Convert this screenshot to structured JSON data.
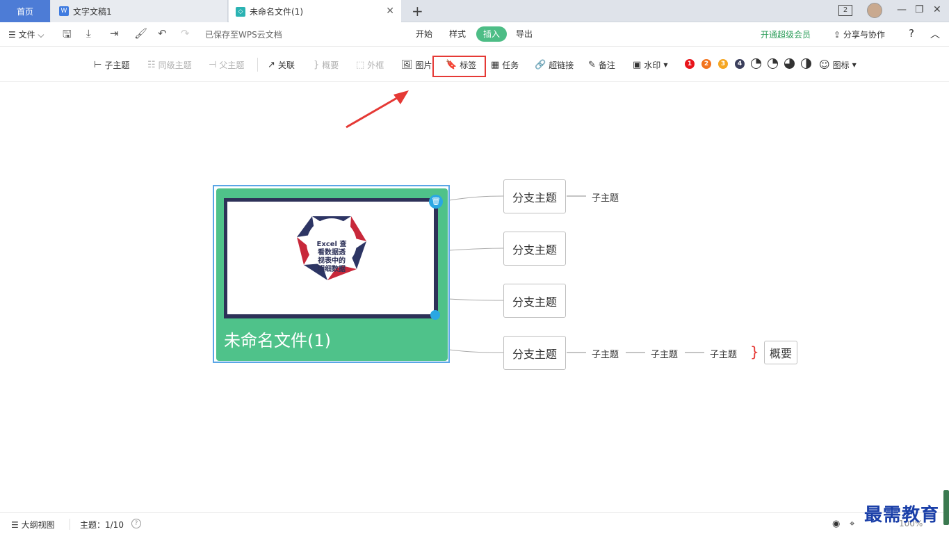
{
  "tabs": {
    "home": "首页",
    "doc": "文字文稿1",
    "active": "未命名文件(1)",
    "window_count": "2"
  },
  "menubar": {
    "file": "文件",
    "saved_status": "已保存至WPS云文档",
    "tabs": [
      "开始",
      "样式",
      "插入",
      "导出"
    ],
    "vip": "开通超级会员",
    "share": "分享与协作",
    "help": "?"
  },
  "toolbar": {
    "subtopic": "子主题",
    "sibling": "同级主题",
    "parent": "父主题",
    "relation": "关联",
    "summary": "概要",
    "frame": "外框",
    "image": "图片",
    "label": "标签",
    "task": "任务",
    "hyperlink": "超链接",
    "note": "备注",
    "watermark": "水印",
    "priorities": [
      "1",
      "2",
      "3",
      "4"
    ],
    "icon": "图标"
  },
  "colors": {
    "accent": "#4dbd86",
    "tab_home": "#4d7cd6",
    "highlight": "#e53935",
    "priority": [
      "#e8141b",
      "#f2741e",
      "#f5a623",
      "#3b3f5c"
    ]
  },
  "mindmap": {
    "root_title": "未命名文件(1)",
    "root_image_text": [
      "Excel 查",
      "看数据透",
      "视表中的",
      "明细数据"
    ],
    "branches": [
      "分支主题",
      "分支主题",
      "分支主题",
      "分支主题"
    ],
    "subtopic": "子主题",
    "summary": "概要"
  },
  "statusbar": {
    "outline": "大纲视图",
    "topic_count": "主题：1/10",
    "zoom": "100%"
  },
  "watermark": "最需教育"
}
